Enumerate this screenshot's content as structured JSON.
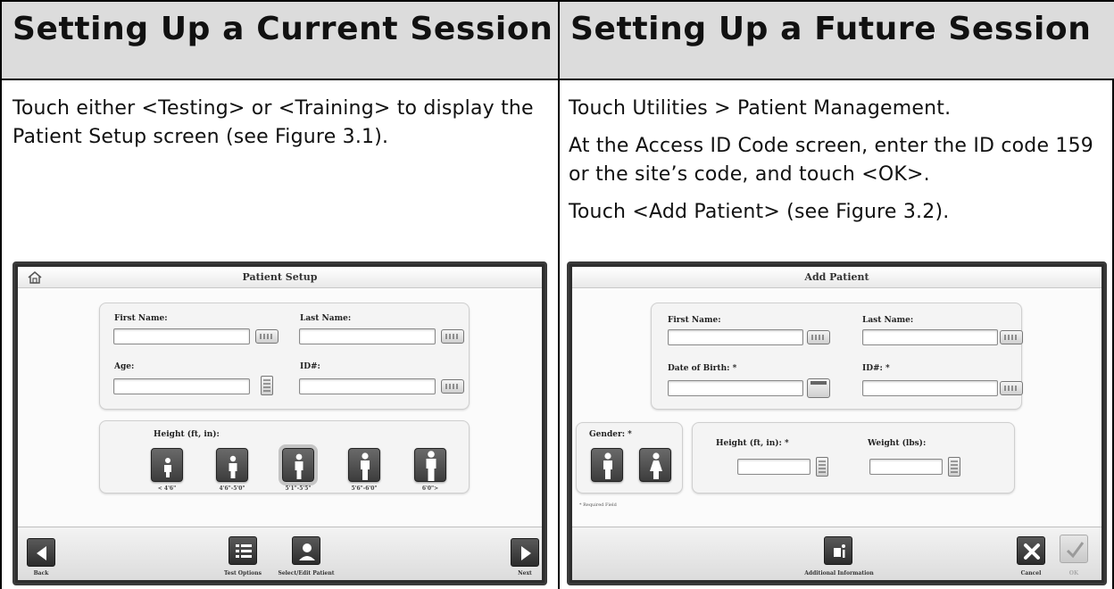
{
  "left": {
    "heading": "Setting Up a Current Session",
    "paragraphs": [
      "Touch either <Testing> or <Training> to display the Patient Setup screen (see Figure 3.1)."
    ],
    "screen": {
      "title": "Patient Setup",
      "first_name_label": "First Name:",
      "last_name_label": "Last Name:",
      "age_label": "Age:",
      "id_label": "ID#:",
      "height_label": "Height (ft, in):",
      "height_options": [
        "< 4'6\"",
        "4'6\"-5'0\"",
        "5'1\"-5'5\"",
        "5'6\"-6'0\"",
        "6'0\">"
      ],
      "selected_height_index": 2,
      "back_label": "Back",
      "test_options_label": "Test Options",
      "select_edit_label": "Select/Edit Patient",
      "next_label": "Next"
    }
  },
  "right": {
    "heading": "Setting Up a Future Session",
    "paragraphs": [
      "Touch Utilities > Patient Management.",
      "At the Access ID Code screen, enter the ID code 159 or the site’s code, and touch <OK>.",
      "Touch <Add Patient> (see Figure 3.2)."
    ],
    "screen": {
      "title": "Add Patient",
      "first_name_label": "First Name:",
      "last_name_label": "Last Name:",
      "dob_label": "Date of Birth: *",
      "id_label": "ID#: *",
      "gender_label": "Gender: *",
      "height_label": "Height (ft, in): *",
      "weight_label": "Weight (lbs):",
      "required_note": "* Required Field",
      "additional_label": "Additional Information",
      "cancel_label": "Cancel",
      "ok_label": "OK"
    }
  },
  "colors": {
    "header_bg": "#dcdcdc",
    "border": "#000000",
    "device_frame": "#2e2e2e"
  }
}
